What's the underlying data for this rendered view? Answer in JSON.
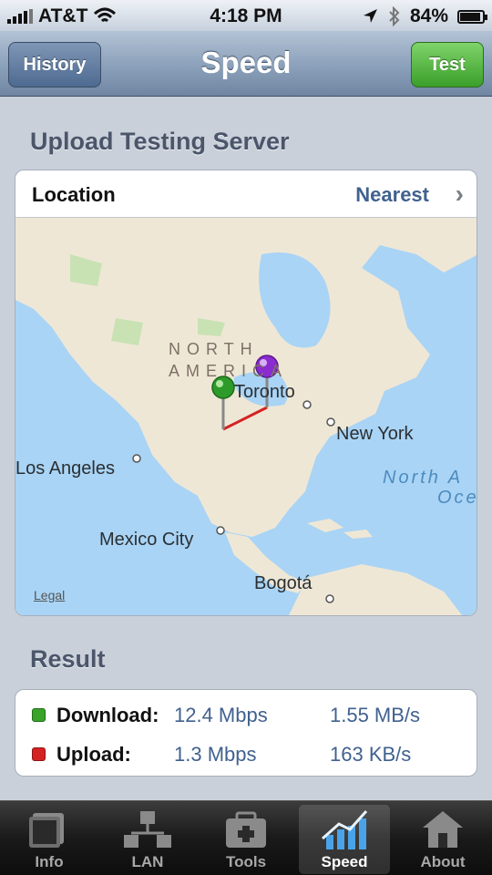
{
  "status_bar": {
    "carrier": "AT&T",
    "time": "4:18 PM",
    "battery": "84%"
  },
  "nav": {
    "title": "Speed",
    "left_button": "History",
    "right_button": "Test"
  },
  "server_section": {
    "title": "Upload Testing Server",
    "location_label": "Location",
    "location_value": "Nearest"
  },
  "map": {
    "region": "NORTH AMERICA",
    "cities": [
      "Toronto",
      "New York",
      "Los Angeles",
      "Mexico City",
      "Bogotá"
    ],
    "ocean_line1": "North A",
    "ocean_line2": "Oce",
    "legal": "Legal"
  },
  "result_section": {
    "title": "Result",
    "rows": [
      {
        "label": "Download:",
        "rate": "12.4 Mbps",
        "bytes": "1.55 MB/s",
        "color": "#3aa32a"
      },
      {
        "label": "Upload:",
        "rate": "1.3 Mbps",
        "bytes": "163 KB/s",
        "color": "#d32222"
      }
    ]
  },
  "tabs": [
    {
      "label": "Info",
      "icon": "info-icon"
    },
    {
      "label": "LAN",
      "icon": "network-icon"
    },
    {
      "label": "Tools",
      "icon": "toolbox-icon"
    },
    {
      "label": "Speed",
      "icon": "chart-icon",
      "active": true
    },
    {
      "label": "About",
      "icon": "house-icon"
    }
  ],
  "colors": {
    "accent": "#41618f",
    "test_button": "#3b9f2a",
    "nav_bar": "#6f86a3"
  }
}
